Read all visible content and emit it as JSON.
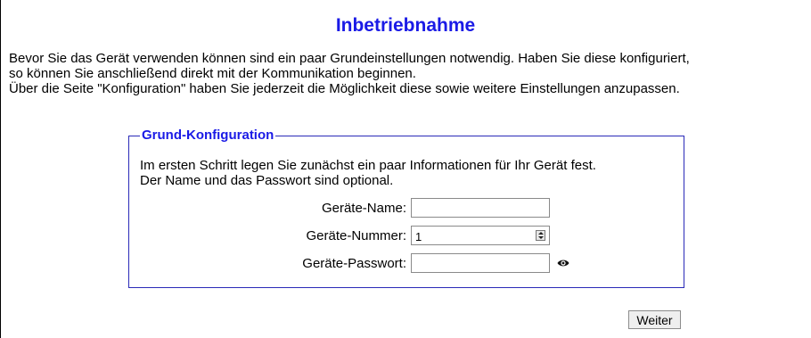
{
  "page": {
    "title": "Inbetriebnahme",
    "intro_lines": [
      "Bevor Sie das Gerät verwenden können sind ein paar Grundeinstellungen notwendig. Haben Sie diese konfiguriert,",
      "so können Sie anschließend direkt mit der Kommunikation beginnen.",
      "Über die Seite \"Konfiguration\" haben Sie jederzeit die Möglichkeit diese sowie weitere Einstellungen anzupassen."
    ]
  },
  "config": {
    "legend": "Grund-Konfiguration",
    "description_lines": [
      "Im ersten Schritt legen Sie zunächst ein paar Informationen für Ihr Gerät fest.",
      "Der Name und das Passwort sind optional."
    ],
    "fields": {
      "name": {
        "label": "Geräte-Name:",
        "value": ""
      },
      "number": {
        "label": "Geräte-Nummer:",
        "value": "1"
      },
      "password": {
        "label": "Geräte-Passwort:",
        "value": "",
        "icon": "eye-icon"
      }
    }
  },
  "actions": {
    "next_label": "Weiter"
  },
  "colors": {
    "accent": "#1a1ae6",
    "fieldset_border": "#2a2ab8"
  }
}
